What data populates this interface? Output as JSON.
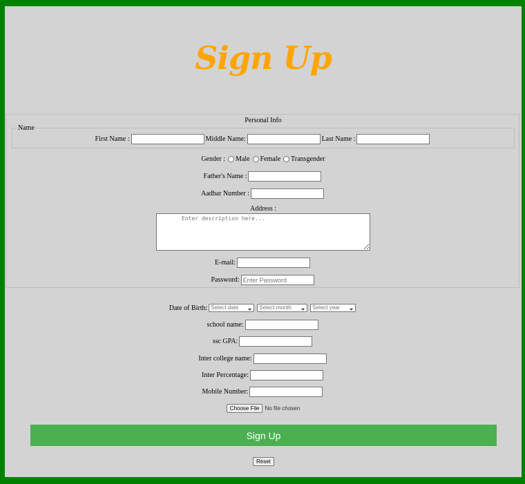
{
  "page": {
    "title": "Sign Up",
    "colors": {
      "border": "#008000",
      "panel": "#d3d3d3",
      "title": "#ffa500",
      "submit": "#4caf50"
    }
  },
  "personal_info": {
    "legend": "Personal Info",
    "name_group": {
      "legend": "Name",
      "first_label": "First Name :",
      "middle_label": "Middle Name:",
      "last_label": "Last Name :"
    },
    "gender": {
      "label": "Gender :",
      "options": [
        "Male",
        "Female",
        "Transgender"
      ]
    },
    "father_label": "Father's Name :",
    "aadhar_label": "Aadhar Number :",
    "address": {
      "label": "Address :",
      "placeholder": "Enter description here..."
    },
    "email_label": "E-mail:",
    "password": {
      "label": "Password:",
      "placeholder": "Enter Password"
    }
  },
  "other": {
    "dob": {
      "label": "Date of Birth:",
      "date_placeholder": "Select date",
      "month_placeholder": "Select month",
      "year_placeholder": "Select year"
    },
    "school_label": "school name:",
    "ssc_label": "ssc GPA:",
    "inter_college_label": "Inter college name:",
    "inter_percentage_label": "Inter Percentage:",
    "mobile_label": "Mobile Number:",
    "file": {
      "button": "Choose File",
      "status": "No file chosen"
    }
  },
  "actions": {
    "submit": "Sign Up",
    "reset": "Reset"
  }
}
